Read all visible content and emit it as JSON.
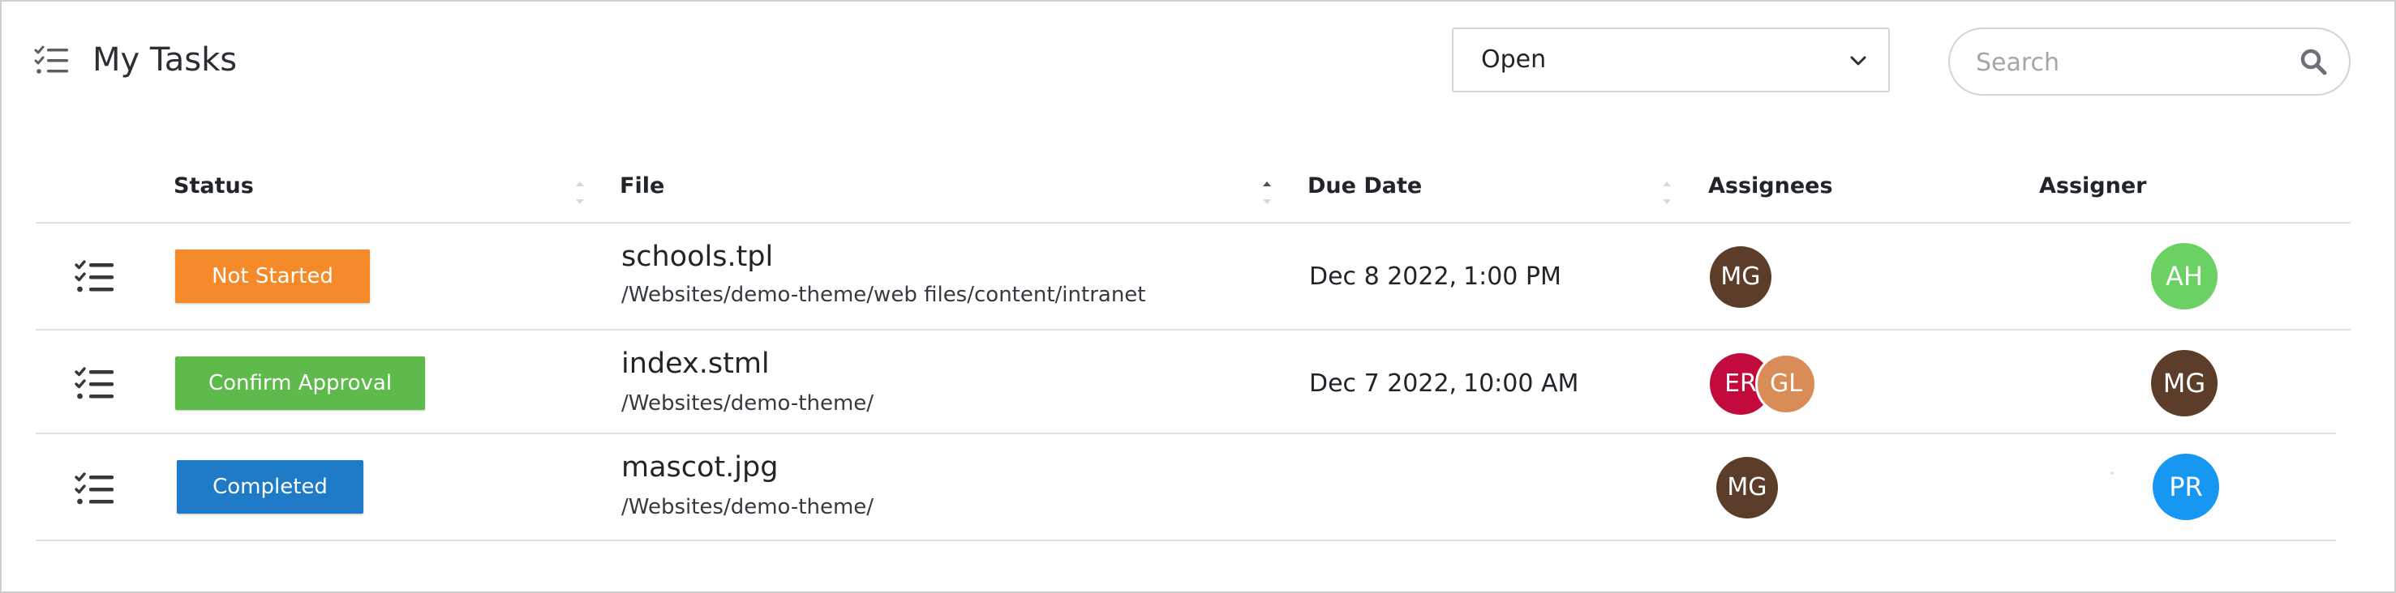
{
  "header": {
    "title": "My Tasks",
    "filter": {
      "selected": "Open"
    },
    "search": {
      "placeholder": "Search",
      "value": ""
    }
  },
  "table": {
    "columns": {
      "status": "Status",
      "file": "File",
      "due_date": "Due Date",
      "assignees": "Assignees",
      "assigner": "Assigner"
    },
    "rows": [
      {
        "status": "Not Started",
        "status_color": "#f58a2a",
        "file_name": "schools.tpl",
        "file_path": "/Websites/demo-theme/web files/content/intranet",
        "due_date": "Dec 8 2022,",
        "due_time": "1:00 PM",
        "assignees": [
          {
            "initials": "MG",
            "color": "#5c3d2a"
          }
        ],
        "assigner": {
          "initials": "AH",
          "color": "#6bd163"
        }
      },
      {
        "status": "Confirm Approval",
        "status_color": "#5dba4b",
        "file_name": "index.stml",
        "file_path": "/Websites/demo-theme/",
        "due_date": "Dec 7 2022,",
        "due_time": "10:00 AM",
        "assignees": [
          {
            "initials": "ER",
            "color": "#c20a3c"
          },
          {
            "initials": "GL",
            "color": "#d98b58"
          }
        ],
        "assigner": {
          "initials": "MG",
          "color": "#5c3d2a"
        }
      },
      {
        "status": "Completed",
        "status_color": "#1f7ac8",
        "file_name": "mascot.jpg",
        "file_path": "/Websites/demo-theme/",
        "due_date": "",
        "due_time": "",
        "assignees": [
          {
            "initials": "MG",
            "color": "#5c3d2a"
          }
        ],
        "assigner": {
          "initials": "PR",
          "color": "#1797f2"
        }
      }
    ]
  },
  "colors": {
    "border": "#dee2e6",
    "text": "#212529",
    "placeholder": "#a2a7ad"
  },
  "icons": [
    "task-list-icon",
    "chevron-down-icon",
    "search-icon",
    "sort-icon"
  ]
}
